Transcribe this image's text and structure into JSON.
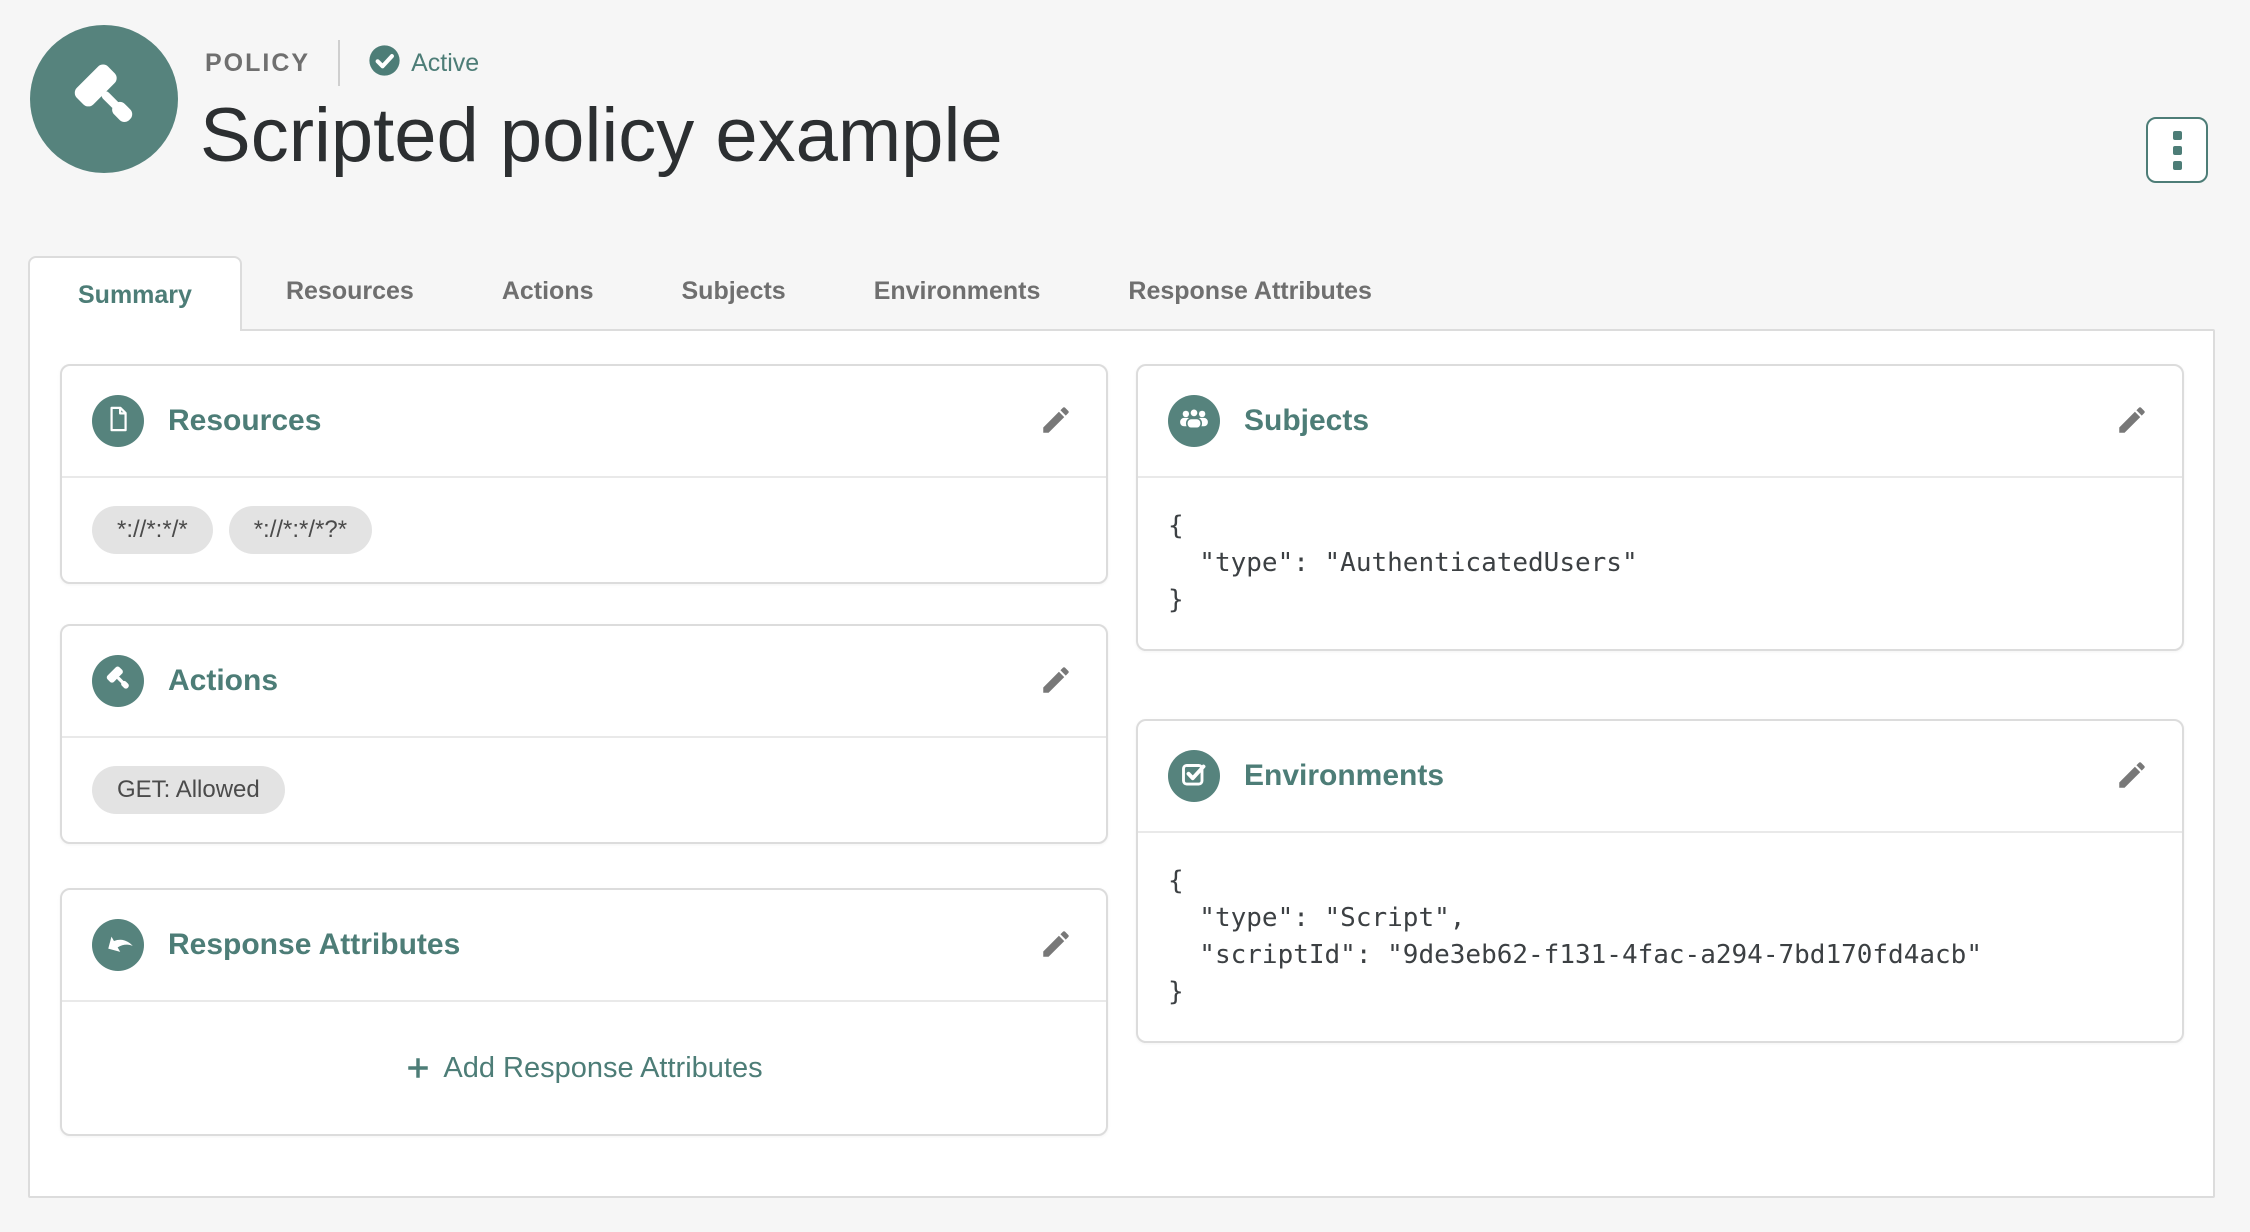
{
  "header": {
    "type_label": "POLICY",
    "status": "Active",
    "title": "Scripted policy example"
  },
  "tabs": [
    {
      "label": "Summary",
      "active": true
    },
    {
      "label": "Resources",
      "active": false
    },
    {
      "label": "Actions",
      "active": false
    },
    {
      "label": "Subjects",
      "active": false
    },
    {
      "label": "Environments",
      "active": false
    },
    {
      "label": "Response Attributes",
      "active": false
    }
  ],
  "cards": {
    "resources": {
      "title": "Resources",
      "tags": [
        "*://*:*/*",
        "*://*:*/*?*"
      ]
    },
    "actions": {
      "title": "Actions",
      "tags": [
        "GET: Allowed"
      ]
    },
    "response_attributes": {
      "title": "Response Attributes",
      "add_label": "Add Response Attributes"
    },
    "subjects": {
      "title": "Subjects",
      "code": "{\n  \"type\": \"AuthenticatedUsers\"\n}"
    },
    "environments": {
      "title": "Environments",
      "code": "{\n  \"type\": \"Script\",\n  \"scriptId\": \"9de3eb62-f131-4fac-a294-7bd170fd4acb\"\n}"
    }
  },
  "colors": {
    "brand_teal": "#56837d",
    "text_teal": "#4d7d77",
    "page_bg": "#f6f6f6"
  }
}
